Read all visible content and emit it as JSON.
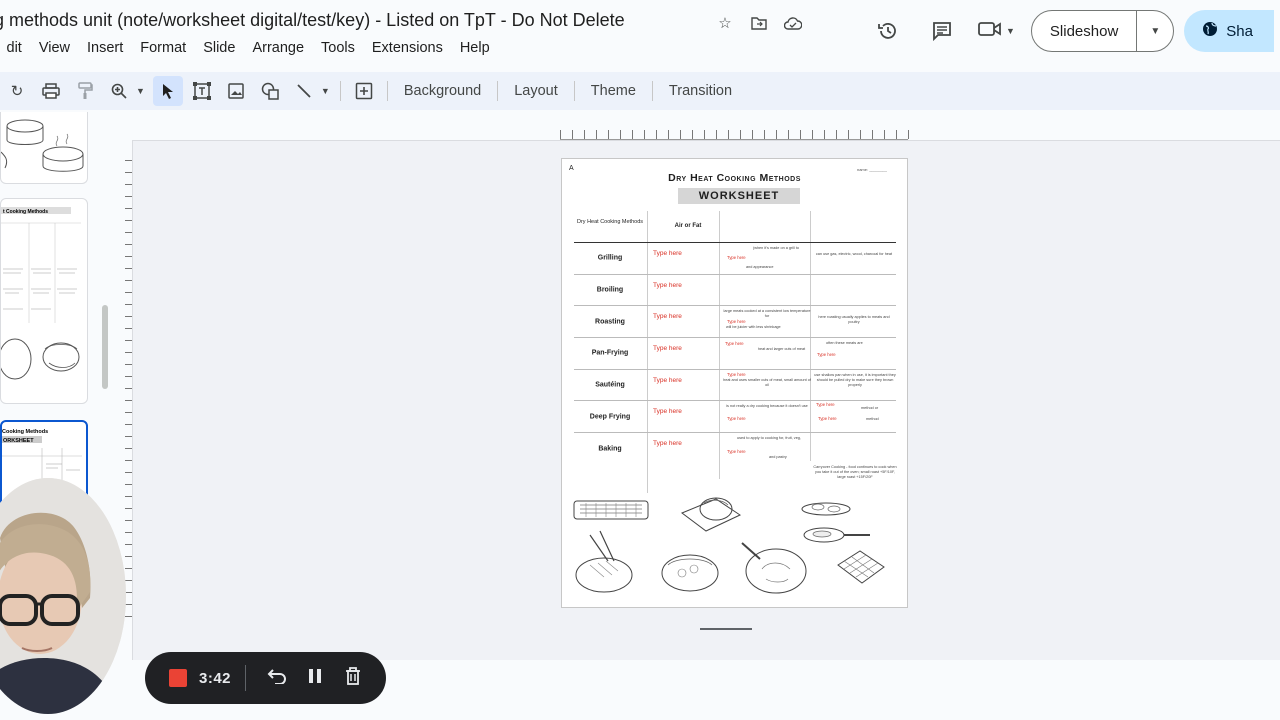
{
  "window": {
    "doc_title": "g methods unit (note/worksheet digital/test/key) - Listed on TpT - Do Not Delete"
  },
  "menu": [
    "dit",
    "View",
    "Insert",
    "Format",
    "Slide",
    "Arrange",
    "Tools",
    "Extensions",
    "Help"
  ],
  "actions": {
    "slideshow_label": "Slideshow",
    "share_label": "Sha"
  },
  "toolbar": {
    "background_label": "Background",
    "layout_label": "Layout",
    "theme_label": "Theme",
    "transition_label": "Transition"
  },
  "worksheet": {
    "letter": "A",
    "name_line": "name: ________",
    "title": "Dry Heat Cooking Methods",
    "subtitle": "WORKSHEET",
    "header_col1": "Dry Heat Cooking Methods",
    "header_col2": "Air or Fat",
    "rows": [
      {
        "method": "Grilling",
        "placeholder": "Type here"
      },
      {
        "method": "Broiling",
        "placeholder": "Type here"
      },
      {
        "method": "Roasting",
        "placeholder": "Type here"
      },
      {
        "method": "Pan-Frying",
        "placeholder": "Type here"
      },
      {
        "method": "Sautéing",
        "placeholder": "Type here"
      },
      {
        "method": "Deep Frying",
        "placeholder": "Type here"
      },
      {
        "method": "Baking",
        "placeholder": "Type here"
      }
    ],
    "notes": {
      "grilling_c3": "(when it's made on a grill to",
      "grilling_c3b": "and appearance",
      "grilling_c4": "can use gas, electric, wood, charcoal for heat",
      "roasting_c3": "large meats cooked at a consistent low temperature for",
      "roasting_c3b": "will be juicier with less shrinkage",
      "roasting_c4": "here roasting usually applies to meats and poultry",
      "pan_c3": "heat and larger cuts of meat",
      "pan_c4": "often these meats are",
      "saute_c3": "heat and uses smaller cuts of meat, small amount of oil",
      "saute_c4": "use shallow pan when in use, it is important they should be pulled dry to make sure they brown properly",
      "deep_c3": "is not really a dry cooking because it doesn't use",
      "deep_c4a": "method or",
      "deep_c4b": "method",
      "baking_c3": "used to apply to cooking for, fruit, veg,",
      "baking_c3b": "and pastry",
      "baking_c4": "Carryover Cooking - food continues to cook when you take it out of the oven; small roast +5F/10F, large roast +15F/20F",
      "red_small": "Type here"
    }
  },
  "recorder": {
    "time": "3:42"
  },
  "icons": [
    "star-icon",
    "move-to-folder-icon",
    "cloud-status-icon",
    "history-icon",
    "comment-icon",
    "camera-icon",
    "globe-icon",
    "undo-icon",
    "pause-icon",
    "delete-icon"
  ]
}
